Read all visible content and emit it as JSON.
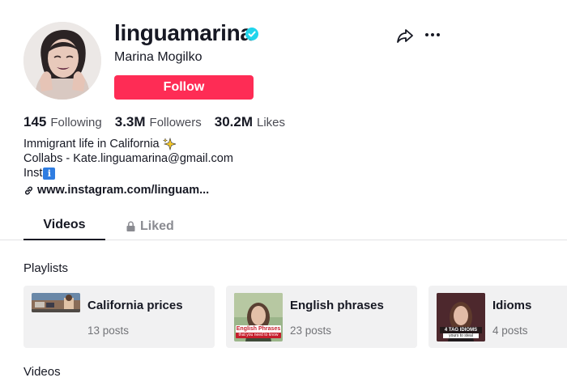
{
  "profile": {
    "username": "linguamarina",
    "nickname": "Marina Mogilko",
    "follow_label": "Follow",
    "verified": true
  },
  "stats": [
    {
      "value": "145",
      "label": "Following"
    },
    {
      "value": "3.3M",
      "label": "Followers"
    },
    {
      "value": "30.2M",
      "label": "Likes"
    }
  ],
  "bio": {
    "line1": "Immigrant life in California",
    "line2": "Collabs - Kate.linguamarina@gmail.com",
    "line3": "Inst"
  },
  "link": "www.instagram.com/linguam...",
  "tabs": [
    {
      "label": "Videos",
      "active": true
    },
    {
      "label": "Liked",
      "active": false
    }
  ],
  "playlists": {
    "title": "Playlists",
    "items": [
      {
        "title": "California prices",
        "count": "13 posts"
      },
      {
        "title": "English phrases",
        "count": "23 posts",
        "thumb_text": "English Phrases",
        "thumb_sub": "that you need to know"
      },
      {
        "title": "Idioms",
        "count": "4 posts",
        "thumb_text": "4 TAG IDIOMS",
        "thumb_sub": "yours to steal"
      }
    ]
  },
  "videos_title": "Videos",
  "icons": {
    "share": "share-icon",
    "more": "more-icon",
    "verified": "verified-badge-icon",
    "link": "link-icon",
    "lock": "lock-icon"
  },
  "colors": {
    "accent": "#fe2c55",
    "verified": "#20d5ec",
    "card_bg": "#f1f1f2"
  }
}
